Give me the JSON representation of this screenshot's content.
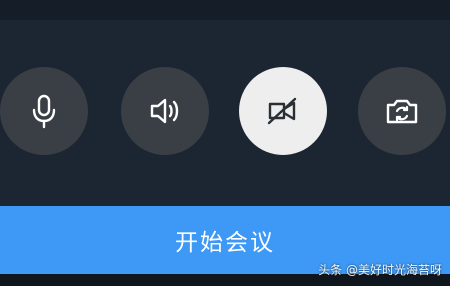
{
  "controls": [
    {
      "id": "mic",
      "icon": "microphone-icon",
      "state": "off"
    },
    {
      "id": "speaker",
      "icon": "speaker-icon",
      "state": "off"
    },
    {
      "id": "camera",
      "icon": "camera-off-icon",
      "state": "on"
    },
    {
      "id": "flip",
      "icon": "camera-switch-icon",
      "state": "off"
    }
  ],
  "start_button": {
    "label": "开始会议"
  },
  "watermark": {
    "text": "头条 @美好时光海苔呀"
  },
  "colors": {
    "background": "#1c2632",
    "control_inactive": "#3a3f45",
    "control_active": "#eeeeee",
    "button_primary": "#3d99f5"
  }
}
